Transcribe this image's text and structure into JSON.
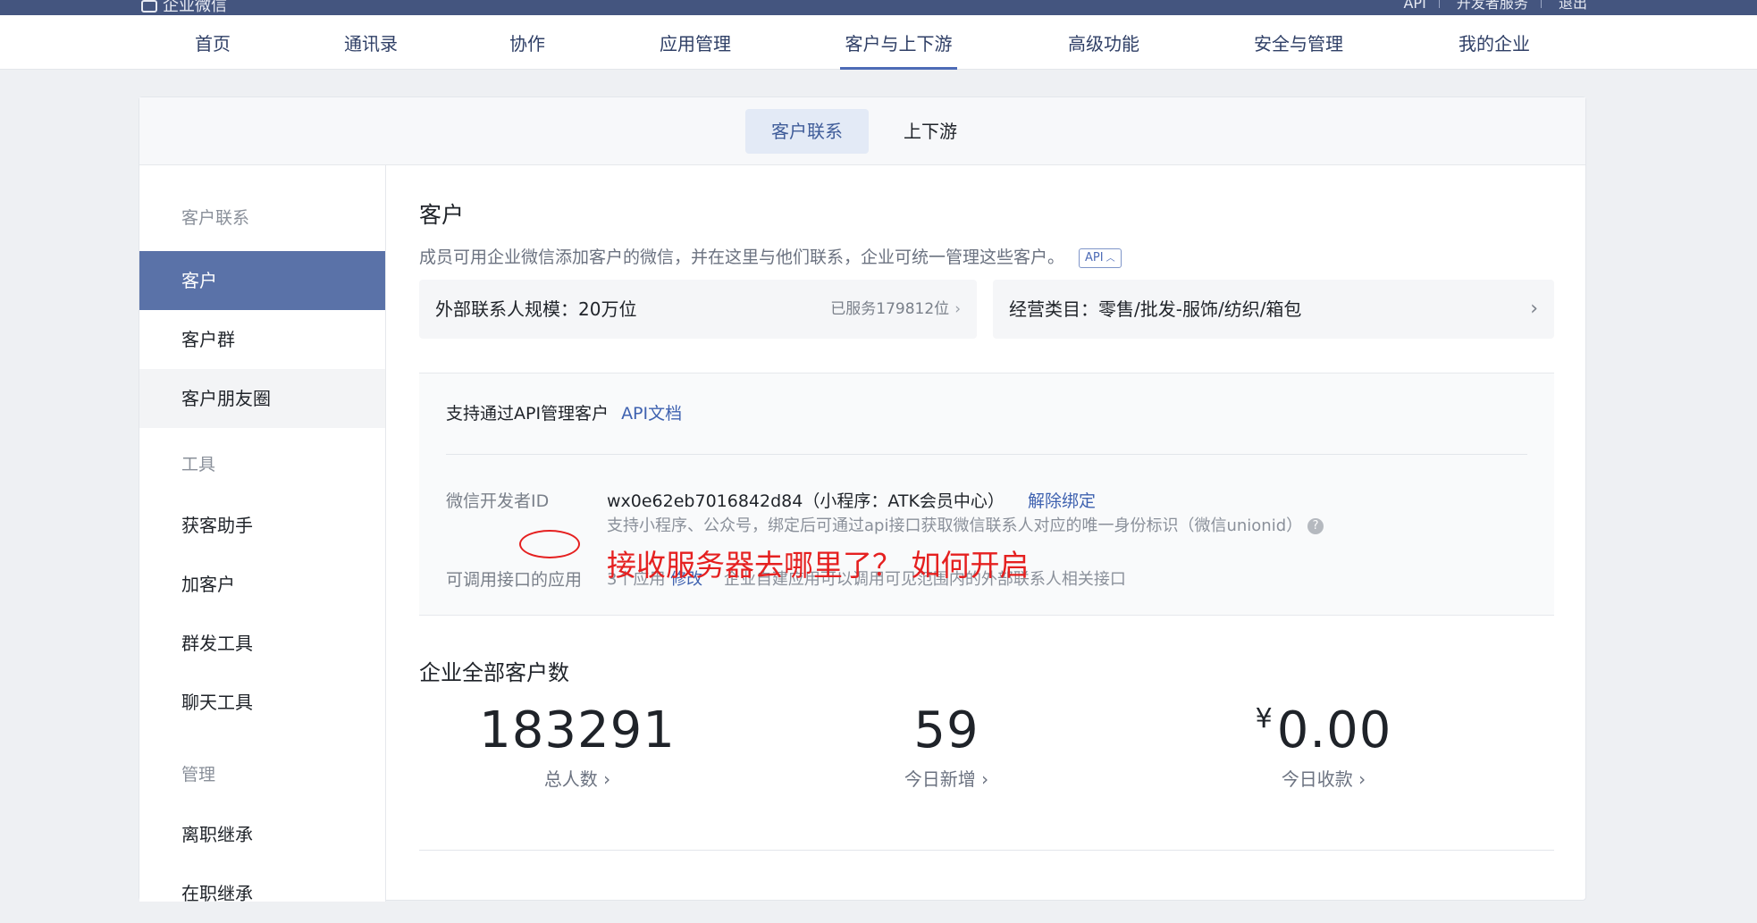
{
  "topbar": {
    "brand": "企业微信",
    "links": [
      "API",
      "开发者服务",
      "退出"
    ]
  },
  "main_nav": [
    {
      "label": "首页"
    },
    {
      "label": "通讯录"
    },
    {
      "label": "协作"
    },
    {
      "label": "应用管理"
    },
    {
      "label": "客户与上下游",
      "active": true
    },
    {
      "label": "高级功能"
    },
    {
      "label": "安全与管理"
    },
    {
      "label": "我的企业"
    }
  ],
  "sub_tabs": [
    {
      "label": "客户联系",
      "active": true
    },
    {
      "label": "上下游"
    }
  ],
  "sidebar": {
    "group1": "客户联系",
    "items1": [
      "客户",
      "客户群",
      "客户朋友圈"
    ],
    "group2": "工具",
    "items2": [
      "获客助手",
      "加客户",
      "群发工具",
      "聊天工具"
    ],
    "group3": "管理",
    "items3": [
      "离职继承",
      "在职继承"
    ]
  },
  "content": {
    "title": "客户",
    "desc": "成员可用企业微信添加客户的微信，并在这里与他们联系，企业可统一管理这些客户。",
    "api_badge": "API",
    "scale_box": {
      "label": "外部联系人规模：20万位",
      "served": "已服务179812位"
    },
    "category_box": {
      "label": "经营类目：零售/批发-服饰/纺织/箱包"
    },
    "api_panel": {
      "heading": "支持通过API管理客户",
      "doc_link": "API文档",
      "dev_id_label": "微信开发者ID",
      "dev_id_value": "wx0e62eb7016842d84（小程序：ATK会员中心）",
      "unbind_link": "解除绑定",
      "dev_id_hint": "支持小程序、公众号，绑定后可通过api接口获取微信联系人对应的唯一身份标识（微信unionid）",
      "apps_label": "可调用接口的应用",
      "apps_count": "3个应用",
      "apps_edit": "修改",
      "apps_hint": "企业自建应用可以调用可见范围内的外部联系人相关接口"
    },
    "annotation": "接收服务器去哪里了？ 如何开启",
    "stats_title": "企业全部客户数",
    "stats": [
      {
        "value": "183291",
        "caption": "总人数"
      },
      {
        "value": "59",
        "caption": "今日新增"
      },
      {
        "currency": "¥",
        "value": "0.00",
        "caption": "今日收款"
      }
    ]
  },
  "colors": {
    "topbar": "#44557f",
    "accent": "#4d6bb6",
    "sidebar_active": "#5a72a8",
    "link": "#3f62b0",
    "annotation": "#e52020"
  }
}
